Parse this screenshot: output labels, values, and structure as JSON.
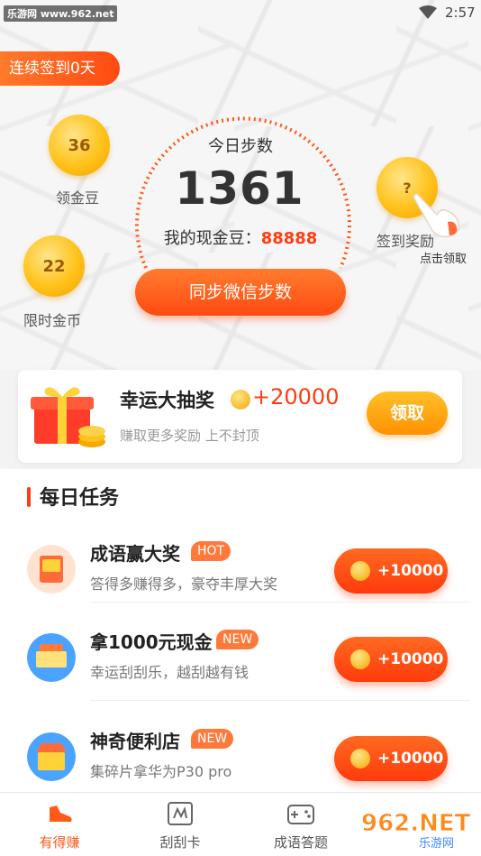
{
  "status_bar": {
    "watermark": "乐游网 www.962.net",
    "time": "2:57"
  },
  "streak_badge": "连续签到0天",
  "coins": [
    {
      "value": "36",
      "label": "领金豆"
    },
    {
      "value": "22",
      "label": "限时金币"
    },
    {
      "value": "?",
      "label": "签到奖励"
    }
  ],
  "tap_hint": "点击领取",
  "steps": {
    "title": "今日步数",
    "value": "1361",
    "cash_label": "我的现金豆：",
    "cash_value": "88888"
  },
  "sync_button": "同步微信步数",
  "lottery": {
    "title": "幸运大抽奖",
    "amount": "+20000",
    "subtitle": "赚取更多奖励 上不封顶",
    "claim_label": "领取"
  },
  "daily_tasks": {
    "title": "每日任务",
    "items": [
      {
        "title": "成语赢大奖",
        "tag": "HOT",
        "desc": "答得多赚得多，豪夺丰厚大奖",
        "reward": "+10000"
      },
      {
        "title": "拿1000元现金",
        "tag": "NEW",
        "desc": "幸运刮刮乐，越刮越有钱",
        "reward": "+10000"
      },
      {
        "title": "神奇便利店",
        "tag": "NEW",
        "desc": "集碎片拿华为P30 pro",
        "reward": "+10000"
      }
    ]
  },
  "bottom_nav": [
    {
      "label": "有得赚",
      "icon": "running-shoe-icon"
    },
    {
      "label": "刮刮卡",
      "icon": "scratch-card-icon"
    },
    {
      "label": "成语答题",
      "icon": "gamepad-icon"
    }
  ],
  "watermark_bottom": "962.NET 乐游网",
  "colors": {
    "accent": "#ff4a12",
    "gold": "#ffc21a"
  }
}
